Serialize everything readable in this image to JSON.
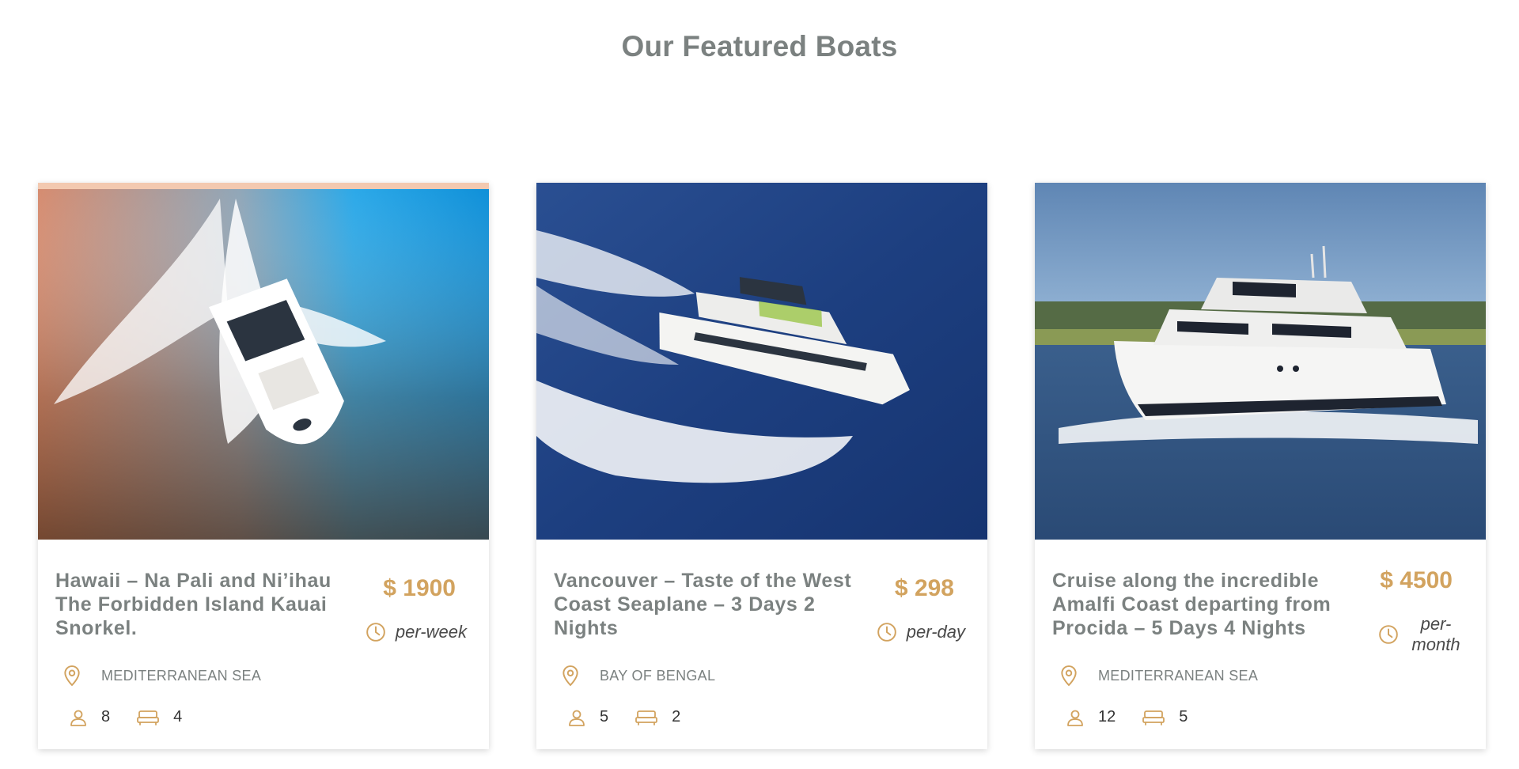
{
  "section": {
    "title": "Our Featured Boats"
  },
  "colors": {
    "accent": "#d2a35f",
    "title_text": "#7b8180",
    "body_text": "#333333"
  },
  "boats": [
    {
      "title": "Hawaii – Na Pali and Ni’ihau The Forbidden Island Kauai Snorkel.",
      "price": "$ 1900",
      "period": "per-week",
      "location": "MEDITERRANEAN SEA",
      "guests": "8",
      "cabins": "4",
      "image_icon": "boat-photo"
    },
    {
      "title": "Vancouver – Taste of the West Coast Seaplane – 3 Days 2 Nights",
      "price": "$ 298",
      "period": "per-day",
      "location": "BAY OF BENGAL",
      "guests": "5",
      "cabins": "2",
      "image_icon": "boat-photo"
    },
    {
      "title": "Cruise along the incredible Amalfi Coast departing from Procida – 5 Days 4 Nights",
      "price": "$ 4500",
      "period": "per-month",
      "location": "MEDITERRANEAN SEA",
      "guests": "12",
      "cabins": "5",
      "image_icon": "boat-photo"
    }
  ],
  "icons": {
    "period": "clock-icon",
    "location": "map-pin-icon",
    "guests": "person-icon",
    "cabins": "bed-icon"
  }
}
